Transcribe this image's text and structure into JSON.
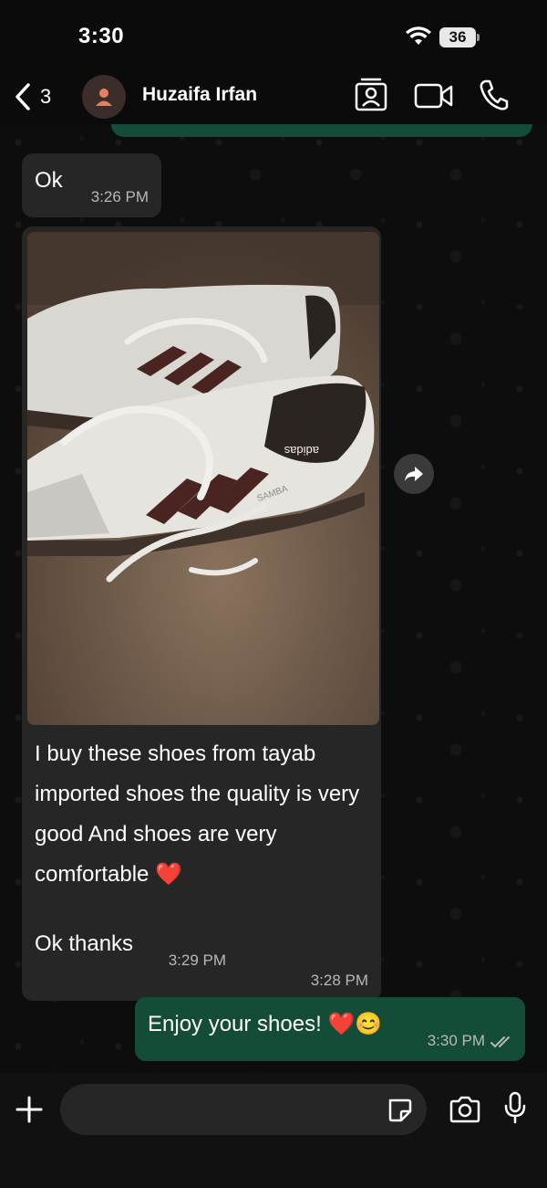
{
  "status_bar": {
    "time": "3:30",
    "battery": "36"
  },
  "header": {
    "back_count": "3",
    "contact_name": "Huzaifa Irfan"
  },
  "messages": [
    {
      "direction": "in",
      "text": "Ok",
      "time": "3:26 PM"
    },
    {
      "direction": "in",
      "type": "image",
      "caption": "I buy these shoes from tayab imported shoes the quality is very good And shoes are very comfortable ❤️",
      "time": "3:28 PM"
    },
    {
      "direction": "in",
      "text": "Ok thanks",
      "time": "3:29 PM"
    },
    {
      "direction": "out",
      "text": "Enjoy your shoes! ❤️😊",
      "time": "3:30 PM",
      "status": "read"
    }
  ],
  "photo": {
    "brand_text": "adidas",
    "model_text": "SAMBA"
  },
  "composer": {
    "placeholder": ""
  },
  "colors": {
    "incoming_bubble": "#262626",
    "outgoing_bubble": "#134d37",
    "background": "#0b0b0b",
    "avatar_accent": "#e8805f"
  },
  "icons": [
    "back-chevron-icon",
    "person-icon",
    "contact-card-icon",
    "video-call-icon",
    "phone-icon",
    "forward-icon",
    "plus-icon",
    "sticker-icon",
    "camera-icon",
    "microphone-icon",
    "double-check-icon",
    "wifi-icon"
  ]
}
